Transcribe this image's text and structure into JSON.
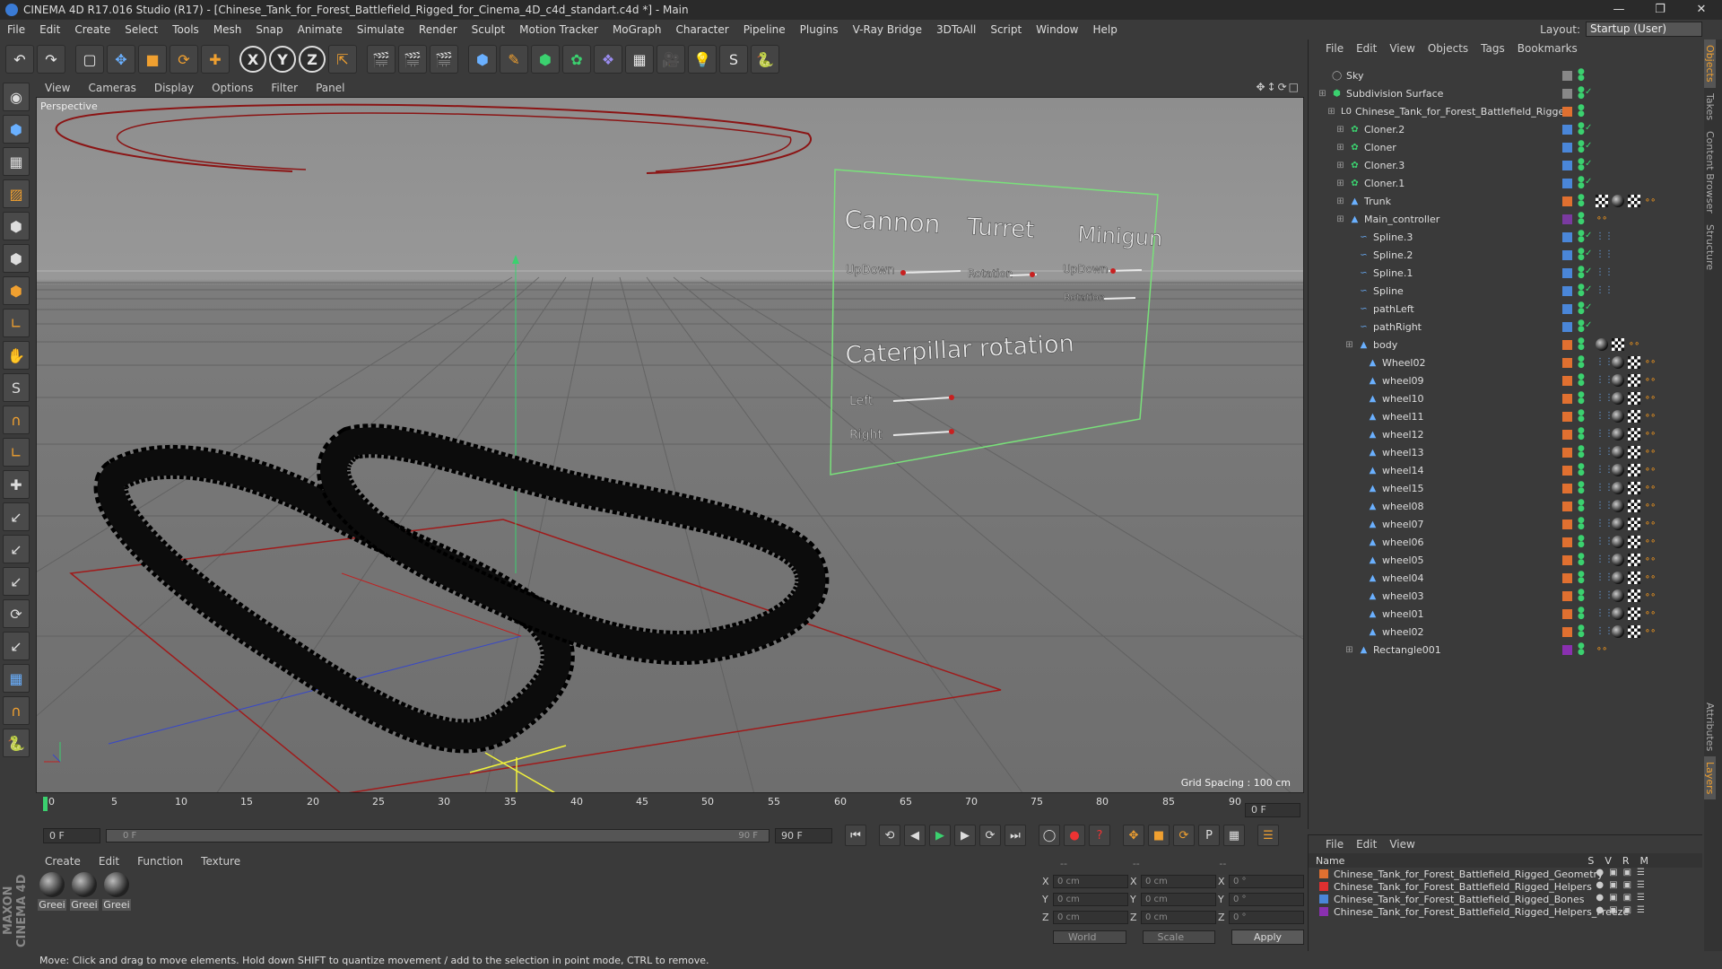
{
  "title": "CINEMA 4D R17.016 Studio (R17) - [Chinese_Tank_for_Forest_Battlefield_Rigged_for_Cinema_4D_c4d_standart.c4d *] - Main",
  "menu": [
    "File",
    "Edit",
    "Create",
    "Select",
    "Tools",
    "Mesh",
    "Snap",
    "Animate",
    "Simulate",
    "Render",
    "Sculpt",
    "Motion Tracker",
    "MoGraph",
    "Character",
    "Pipeline",
    "Plugins",
    "V-Ray Bridge",
    "3DToAll",
    "Script",
    "Window",
    "Help"
  ],
  "layout": {
    "label": "Layout:",
    "value": "Startup (User)"
  },
  "viewport": {
    "menu": [
      "View",
      "Cameras",
      "Display",
      "Options",
      "Filter",
      "Panel"
    ],
    "camera_label": "Perspective",
    "grid_spacing": "Grid Spacing : 100 cm",
    "hud": {
      "cannon": "Cannon",
      "turret": "Turret",
      "minigun": "Minigun",
      "updown1": "UpDown",
      "rotation1": "Rotation",
      "updown2": "UpDown",
      "rotation2": "Rotation",
      "caterpillar": "Caterpillar rotation",
      "left": "Left",
      "right": "Right"
    }
  },
  "timeline": {
    "ticks": [
      "0",
      "5",
      "10",
      "15",
      "20",
      "25",
      "30",
      "35",
      "40",
      "45",
      "50",
      "55",
      "60",
      "65",
      "70",
      "75",
      "80",
      "85",
      "90"
    ],
    "end_frame_field": "0 F",
    "start_field": "0 F",
    "slider_left": "0 F",
    "slider_right": "90 F",
    "max_field": "90 F"
  },
  "materials": {
    "menu": [
      "Create",
      "Edit",
      "Function",
      "Texture"
    ],
    "items": [
      "Greei",
      "Greei",
      "Greei"
    ]
  },
  "coordinates": {
    "header": [
      "--",
      "--",
      "--"
    ],
    "rows": [
      {
        "axis": "X",
        "pos": "0 cm",
        "axis2": "X",
        "size": "0 cm",
        "axis3": "X",
        "rot": "0 °"
      },
      {
        "axis": "Y",
        "pos": "0 cm",
        "axis2": "Y",
        "size": "0 cm",
        "axis3": "Y",
        "rot": "0 °"
      },
      {
        "axis": "Z",
        "pos": "0 cm",
        "axis2": "Z",
        "size": "0 cm",
        "axis3": "Z",
        "rot": "0 °"
      }
    ],
    "space": "World",
    "mode": "Scale",
    "apply": "Apply"
  },
  "status": "Move: Click and drag to move elements. Hold down SHIFT to quantize movement / add to the selection in point mode, CTRL to remove.",
  "objects": {
    "menu": [
      "File",
      "Edit",
      "View",
      "Objects",
      "Tags",
      "Bookmarks"
    ],
    "items": [
      {
        "name": "Sky",
        "color": "#888888",
        "icon": "sky-icon"
      },
      {
        "name": "Subdivision Surface",
        "color": "#888888",
        "icon": "subdivision-icon"
      },
      {
        "name": "Chinese_Tank_for_Forest_Battlefield_Rigged",
        "color": "#e07030",
        "icon": "null-icon"
      },
      {
        "name": "Cloner.2",
        "color": "#4a86d8",
        "icon": "cloner-icon"
      },
      {
        "name": "Cloner",
        "color": "#4a86d8",
        "icon": "cloner-icon"
      },
      {
        "name": "Cloner.3",
        "color": "#4a86d8",
        "icon": "cloner-icon"
      },
      {
        "name": "Cloner.1",
        "color": "#4a86d8",
        "icon": "cloner-icon"
      },
      {
        "name": "Trunk",
        "color": "#e07030",
        "icon": "bone-icon"
      },
      {
        "name": "Main_controller",
        "color": "#7a3aa0",
        "icon": "bone-icon"
      },
      {
        "name": "Spline.3",
        "color": "#4a86d8",
        "icon": "spline-icon"
      },
      {
        "name": "Spline.2",
        "color": "#4a86d8",
        "icon": "spline-icon"
      },
      {
        "name": "Spline.1",
        "color": "#4a86d8",
        "icon": "spline-icon"
      },
      {
        "name": "Spline",
        "color": "#4a86d8",
        "icon": "spline-icon"
      },
      {
        "name": "pathLeft",
        "color": "#4a86d8",
        "icon": "path-icon"
      },
      {
        "name": "pathRight",
        "color": "#4a86d8",
        "icon": "path-icon"
      },
      {
        "name": "body",
        "color": "#e07030",
        "icon": "bone-icon"
      },
      {
        "name": "Wheel02",
        "color": "#e07030",
        "icon": "bone-icon"
      },
      {
        "name": "wheel09",
        "color": "#e07030",
        "icon": "bone-icon"
      },
      {
        "name": "wheel10",
        "color": "#e07030",
        "icon": "bone-icon"
      },
      {
        "name": "wheel11",
        "color": "#e07030",
        "icon": "bone-icon"
      },
      {
        "name": "wheel12",
        "color": "#e07030",
        "icon": "bone-icon"
      },
      {
        "name": "wheel13",
        "color": "#e07030",
        "icon": "bone-icon"
      },
      {
        "name": "wheel14",
        "color": "#e07030",
        "icon": "bone-icon"
      },
      {
        "name": "wheel15",
        "color": "#e07030",
        "icon": "bone-icon"
      },
      {
        "name": "wheel08",
        "color": "#e07030",
        "icon": "bone-icon"
      },
      {
        "name": "wheel07",
        "color": "#e07030",
        "icon": "bone-icon"
      },
      {
        "name": "wheel06",
        "color": "#e07030",
        "icon": "bone-icon"
      },
      {
        "name": "wheel05",
        "color": "#e07030",
        "icon": "bone-icon"
      },
      {
        "name": "wheel04",
        "color": "#e07030",
        "icon": "bone-icon"
      },
      {
        "name": "wheel03",
        "color": "#e07030",
        "icon": "bone-icon"
      },
      {
        "name": "wheel01",
        "color": "#e07030",
        "icon": "bone-icon"
      },
      {
        "name": "wheel02",
        "color": "#e07030",
        "icon": "bone-icon"
      },
      {
        "name": "Rectangle001",
        "color": "#8a30b0",
        "icon": "bone-icon"
      }
    ]
  },
  "layers": {
    "menu": [
      "File",
      "Edit",
      "View"
    ],
    "header": {
      "name": "Name",
      "s": "S",
      "v": "V",
      "r": "R",
      "m": "M"
    },
    "items": [
      {
        "name": "Chinese_Tank_for_Forest_Battlefield_Rigged_Geometry",
        "color": "#e07030"
      },
      {
        "name": "Chinese_Tank_for_Forest_Battlefield_Rigged_Helpers",
        "color": "#e03030"
      },
      {
        "name": "Chinese_Tank_for_Forest_Battlefield_Rigged_Bones",
        "color": "#4a86d8"
      },
      {
        "name": "Chinese_Tank_for_Forest_Battlefield_Rigged_Helpers_Freeze",
        "color": "#8a30b0"
      }
    ]
  },
  "right_tabs": [
    "Objects",
    "Takes",
    "Content Browser",
    "Structure",
    "Attributes",
    "Layers"
  ]
}
